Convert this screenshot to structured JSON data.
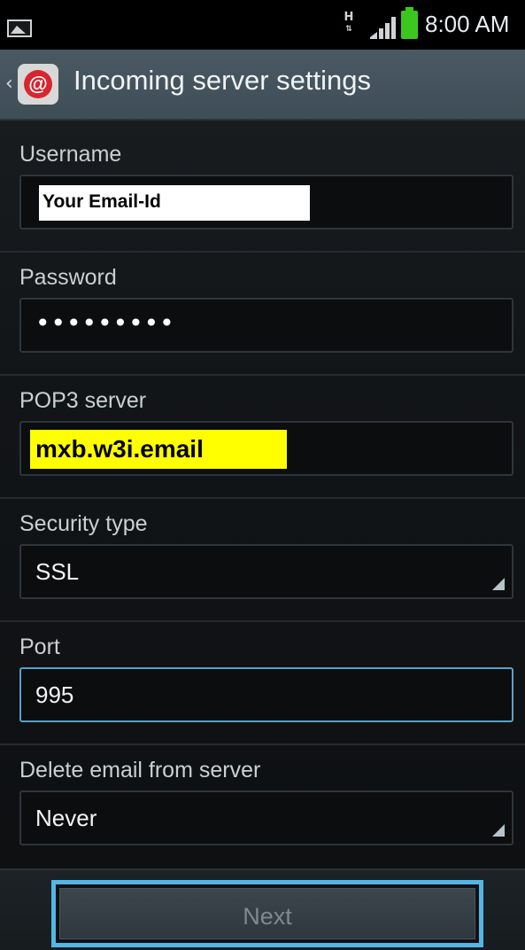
{
  "status_bar": {
    "network_type": "H",
    "time": "8:00 AM",
    "icons": [
      "gallery-notification-icon",
      "hspa-icon",
      "signal-icon",
      "battery-icon"
    ]
  },
  "action_bar": {
    "title": "Incoming server settings",
    "app_icon": "email-app-icon",
    "app_icon_glyph": "@",
    "back_glyph": "‹"
  },
  "form": {
    "username": {
      "label": "Username",
      "value": "Your Email-Id"
    },
    "password": {
      "label": "Password",
      "value": "•••••••••"
    },
    "pop3_server": {
      "label": "POP3 server",
      "value": "mxb.w3i.email"
    },
    "security_type": {
      "label": "Security type",
      "value": "SSL"
    },
    "port": {
      "label": "Port",
      "value": "995"
    },
    "delete_email": {
      "label": "Delete email from server",
      "value": "Never"
    }
  },
  "bottom": {
    "next_label": "Next"
  },
  "colors": {
    "highlight_yellow": "#ffff00",
    "focus_blue": "#5aa0c7",
    "next_border": "#55b5e3",
    "battery_green": "#3cc71f",
    "app_icon_red": "#d7262f"
  }
}
